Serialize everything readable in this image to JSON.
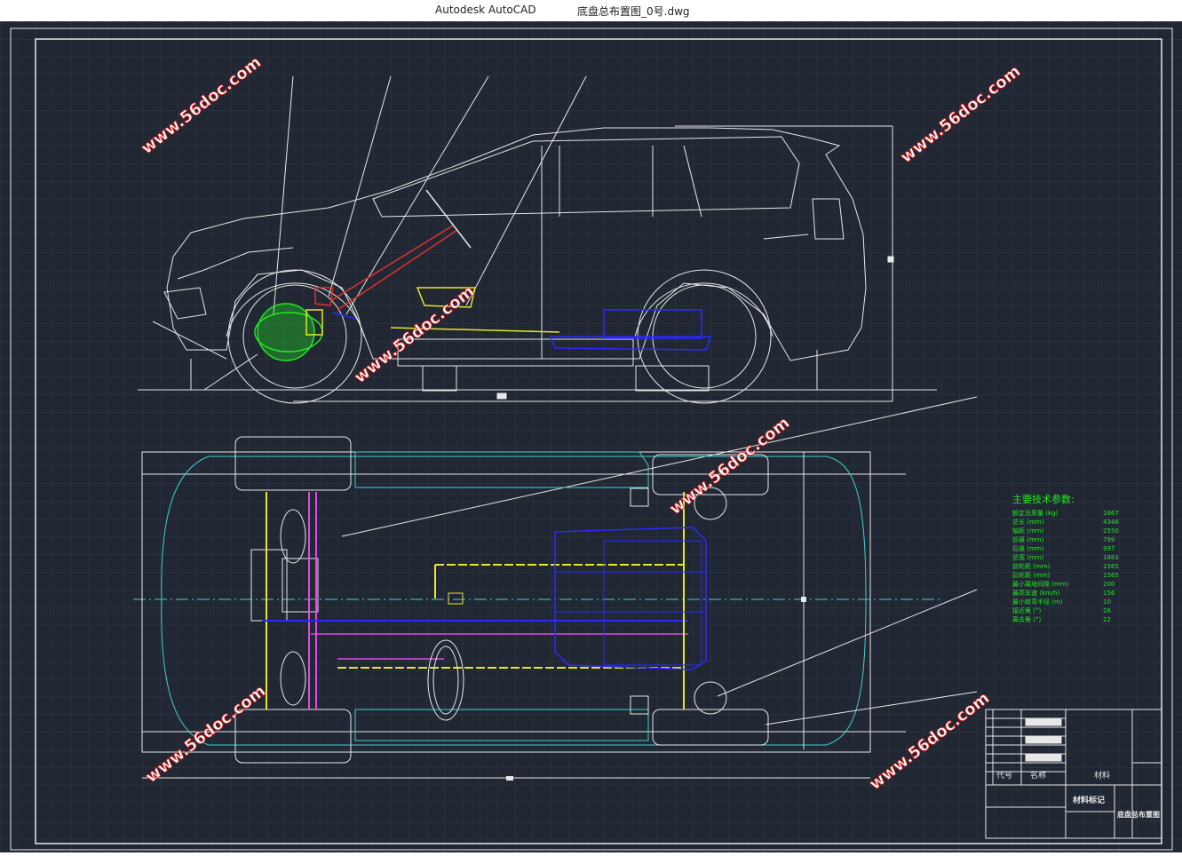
{
  "window": {
    "app_name": "Autodesk AutoCAD",
    "file_name": "底盘总布置图_0号.dwg"
  },
  "watermarks": [
    "www.56doc.com"
  ],
  "colors": {
    "background": "#212833",
    "line_white": "#e8e8e8",
    "cyan": "#3fd0d0",
    "yellow": "#e6e62a",
    "blue": "#2a2aff",
    "green": "#22e622",
    "magenta": "#e04ae0",
    "red": "#e03030"
  },
  "specs": {
    "title": "主要技术参数:",
    "rows": [
      {
        "label": "额定总质量 (kg)",
        "value": "1667"
      },
      {
        "label": "总长 (mm)",
        "value": "4346"
      },
      {
        "label": "轴距 (mm)",
        "value": "2550"
      },
      {
        "label": "前悬 (mm)",
        "value": "799"
      },
      {
        "label": "后悬 (mm)",
        "value": "997"
      },
      {
        "label": "总宽 (mm)",
        "value": "1883"
      },
      {
        "label": "前轮距 (mm)",
        "value": "1565"
      },
      {
        "label": "后轮距 (mm)",
        "value": "1565"
      },
      {
        "label": "最小离地间隙 (mm)",
        "value": "200"
      },
      {
        "label": "最高车速 (km/h)",
        "value": "156"
      },
      {
        "label": "最小转弯半径 (m)",
        "value": "10"
      },
      {
        "label": "接近角 (°)",
        "value": "26"
      },
      {
        "label": "离去角 (°)",
        "value": "22"
      }
    ]
  },
  "title_block": {
    "code_header": "代号",
    "name_header": "名称",
    "material_header": "材料",
    "material_mark": "材料标记",
    "drawing_title": "底盘总布置图"
  }
}
